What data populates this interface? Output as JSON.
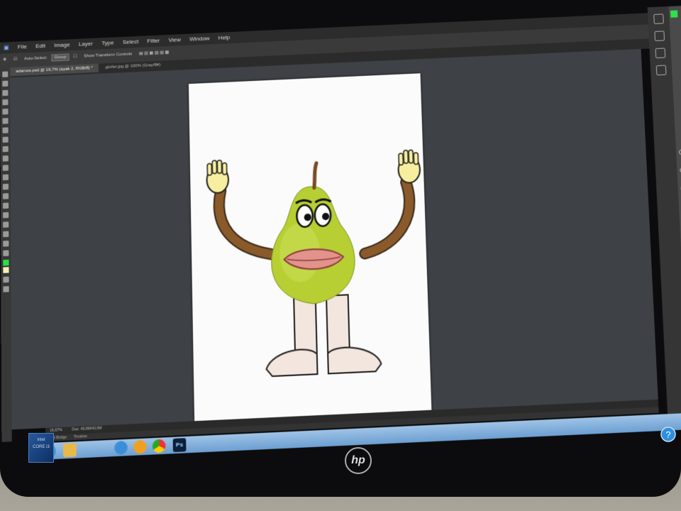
{
  "menubar": {
    "items": [
      "File",
      "Edit",
      "Image",
      "Layer",
      "Type",
      "Select",
      "Filter",
      "View",
      "Window",
      "Help"
    ]
  },
  "optionsbar": {
    "auto_select_label": "Auto-Select:",
    "auto_select_value": "Group",
    "transform_label": "Show Transform Controls"
  },
  "doc_tabs": [
    {
      "label": "adamos.psd @ 16,7% (ayak 2, RGB/8) *",
      "active": true
    },
    {
      "label": "gözler.jpg @ 100% (Gray/8#)",
      "active": false
    }
  ],
  "status": {
    "zoom": "16,67%",
    "doc_info": "Doc: 49,8M/43,6M"
  },
  "bottom_panel": {
    "tabs": [
      "Mini Bridge",
      "Timeline"
    ]
  },
  "colors": {
    "foreground": "#29e14a",
    "background": "#f6f0b8",
    "workspace": "#3e4246"
  },
  "canvas_art": {
    "description_icon": "pear-character-illustration"
  },
  "taskbar": {
    "ps_label": "Ps"
  },
  "hardware": {
    "intel_label": "intel",
    "intel_sub": "CORE i3",
    "brand": "hp"
  }
}
